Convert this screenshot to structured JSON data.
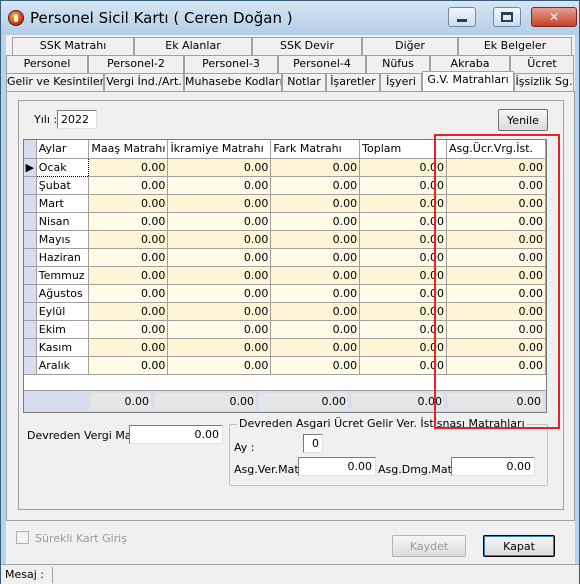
{
  "window": {
    "title": "Personel Sicil Kartı ( Ceren Doğan )",
    "minimize_label": "",
    "maximize_label": "",
    "close_label": "✕"
  },
  "tabs": {
    "row1": [
      "SSK Matrahı",
      "Ek Alanlar",
      "SSK Devir",
      "Diğer",
      "Ek Belgeler"
    ],
    "row2": [
      "Personel",
      "Personel-2",
      "Personel-3",
      "Personel-4",
      "Nüfus",
      "Akraba",
      "Ücret"
    ],
    "row3": [
      "Gelir ve Kesintiler",
      "Vergi İnd./Art.",
      "Muhasebe Kodları",
      "Notlar",
      "İşaretler",
      "İşyeri",
      "G.V. Matrahları",
      "İşsizlik Sg."
    ],
    "active": "G.V. Matrahları"
  },
  "year": {
    "label": "Yılı :",
    "value": "2022"
  },
  "refresh_button": "Yenile",
  "grid": {
    "columns": [
      "Aylar",
      "Maaş Matrahı",
      "İkramiye Matrahı",
      "Fark Matrahı",
      "Toplam",
      "Asg.Ücr.Vrg.İst."
    ],
    "rows": [
      {
        "month": "Ocak",
        "values": [
          "0.00",
          "0.00",
          "0.00",
          "0.00",
          "0.00"
        ]
      },
      {
        "month": "Şubat",
        "values": [
          "0.00",
          "0.00",
          "0.00",
          "0.00",
          "0.00"
        ]
      },
      {
        "month": "Mart",
        "values": [
          "0.00",
          "0.00",
          "0.00",
          "0.00",
          "0.00"
        ]
      },
      {
        "month": "Nisan",
        "values": [
          "0.00",
          "0.00",
          "0.00",
          "0.00",
          "0.00"
        ]
      },
      {
        "month": "Mayıs",
        "values": [
          "0.00",
          "0.00",
          "0.00",
          "0.00",
          "0.00"
        ]
      },
      {
        "month": "Haziran",
        "values": [
          "0.00",
          "0.00",
          "0.00",
          "0.00",
          "0.00"
        ]
      },
      {
        "month": "Temmuz",
        "values": [
          "0.00",
          "0.00",
          "0.00",
          "0.00",
          "0.00"
        ]
      },
      {
        "month": "Ağustos",
        "values": [
          "0.00",
          "0.00",
          "0.00",
          "0.00",
          "0.00"
        ]
      },
      {
        "month": "Eylül",
        "values": [
          "0.00",
          "0.00",
          "0.00",
          "0.00",
          "0.00"
        ]
      },
      {
        "month": "Ekim",
        "values": [
          "0.00",
          "0.00",
          "0.00",
          "0.00",
          "0.00"
        ]
      },
      {
        "month": "Kasım",
        "values": [
          "0.00",
          "0.00",
          "0.00",
          "0.00",
          "0.00"
        ]
      },
      {
        "month": "Aralık",
        "values": [
          "0.00",
          "0.00",
          "0.00",
          "0.00",
          "0.00"
        ]
      }
    ],
    "totals": [
      "0.00",
      "0.00",
      "0.00",
      "0.00",
      "0.00"
    ],
    "selected_row_marker": "▶"
  },
  "carried_tax": {
    "label": "Devreden Vergi Mat:",
    "value": "0.00"
  },
  "min_wage_group": {
    "title": "Devreden Asgari Ücret Gelir Ver. İstisnası Matrahları",
    "month_label": "Ay :",
    "month_value": "0",
    "tax_base_label": "Asg.Ver.Mat:",
    "tax_base_value": "0.00",
    "stamp_base_label": "Asg.Dmg.Mat:",
    "stamp_base_value": "0.00"
  },
  "continuous_entry": {
    "label": "Sürekli Kart Giriş"
  },
  "buttons": {
    "save": "Kaydet",
    "close": "Kapat"
  },
  "status": {
    "label": "Mesaj :"
  }
}
